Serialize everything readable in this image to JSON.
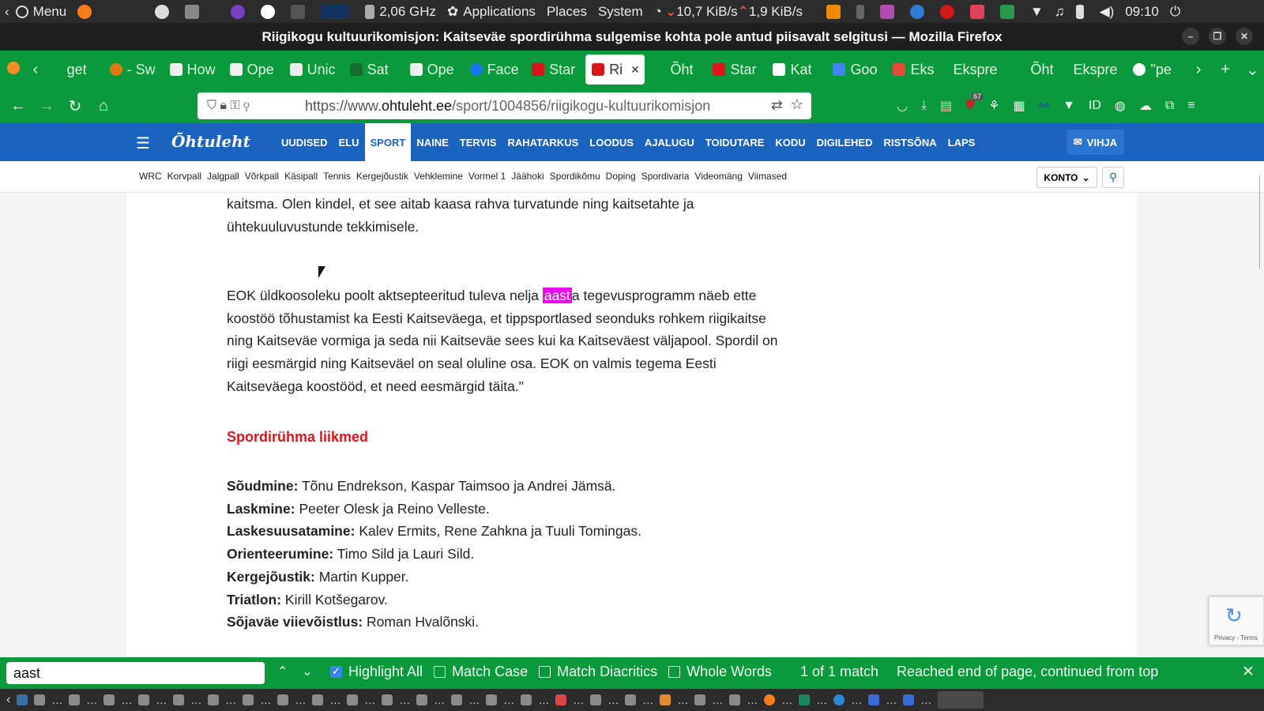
{
  "system_bar": {
    "menu": "Menu",
    "cpu": "2,06 GHz",
    "applications": "Applications",
    "places": "Places",
    "system": "System",
    "download": "10,7 KiB/s",
    "upload": "1,9 KiB/s",
    "clock": "09:10"
  },
  "window": {
    "title": "Riigikogu kultuurikomisjon: Kaitseväe spordirühma sulgemise kohta pole antud piisavalt selgitusi — Mozilla Firefox"
  },
  "tabs": [
    {
      "label": "get"
    },
    {
      "label": "- Sw"
    },
    {
      "label": "How"
    },
    {
      "label": "Ope"
    },
    {
      "label": "Unic"
    },
    {
      "label": "Sat"
    },
    {
      "label": "Ope"
    },
    {
      "label": "Face"
    },
    {
      "label": "Star"
    },
    {
      "label": "Ri"
    },
    {
      "label": "Õht"
    },
    {
      "label": "Star"
    },
    {
      "label": "Kat"
    },
    {
      "label": "Goo"
    },
    {
      "label": "Eks"
    },
    {
      "label": "Ekspre"
    },
    {
      "label": "Õht"
    },
    {
      "label": "Ekspre"
    },
    {
      "label": "\"pe"
    }
  ],
  "url": {
    "scheme": "https://www.",
    "host": "ohtuleht.ee",
    "path": "/sport/1004856/riigikogu-kultuurikomisjon"
  },
  "extension_badge": "67",
  "site": {
    "logo": "Õhtuleht",
    "menu": [
      "UUDISED",
      "ELU",
      "SPORT",
      "NAINE",
      "TERVIS",
      "RAHATARKUS",
      "LOODUS",
      "AJALUGU",
      "TOIDUTARE",
      "KODU",
      "DIGILEHED",
      "RISTSÕNA",
      "LAPS"
    ],
    "vihja": "VIHJA",
    "subnav": [
      "WRC",
      "Korvpall",
      "Jalgpall",
      "Võrkpall",
      "Käsipall",
      "Tennis",
      "Kergejõustik",
      "Vehklemine",
      "Vormel 1",
      "Jäähoki",
      "Spordikõmu",
      "Doping",
      "Spordivaria",
      "Videomäng",
      "Viimased"
    ],
    "konto": "KONTO"
  },
  "article": {
    "p1_line1": "kaitsma. Olen kindel, et see aitab kaasa rahva turvatunde ning kaitsetahte ja",
    "p1_line2": "ühtekuuluvustunde tekkimisele.",
    "p2_before": "EOK üldkoosoleku poolt aktsepteeritud tuleva nelja ",
    "p2_highlight": "aast",
    "p2_after": "a tegevusprogramm näeb ette koostöö tõhustamist ka Eesti Kaitseväega, et tippsportlased seonduks rohkem riigikaitse ning Kaitseväe vormiga ja seda nii Kaitseväe sees kui ka Kaitseväest väljapool. Spordil on riigi eesmärgid ning Kaitseväel on seal oluline osa. EOK on valmis tegema Eesti Kaitseväega koostööd, et need eesmärgid täita.\"",
    "heading": "Spordirühma liikmed",
    "members": [
      {
        "sport": "Sõudmine:",
        "names": "Tõnu Endrekson, Kaspar Taimsoo ja Andrei Jämsä."
      },
      {
        "sport": "Laskmine:",
        "names": "Peeter Olesk ja Reino Velleste."
      },
      {
        "sport": "Laskesuusatamine:",
        "names": "Kalev Ermits, Rene Zahkna ja Tuuli Tomingas."
      },
      {
        "sport": "Orienteerumine:",
        "names": "Timo Sild ja Lauri Sild."
      },
      {
        "sport": "Kergejõustik:",
        "names": "Martin Kupper."
      },
      {
        "sport": "Triatlon:",
        "names": "Kirill Kotšegarov."
      },
      {
        "sport": "Sõjaväe viievõistlus:",
        "names": "Roman Hvalõnski."
      }
    ]
  },
  "recaptcha": "Privacy - Terms",
  "findbar": {
    "query": "aast",
    "highlight_all": "Highlight All",
    "match_case": "Match Case",
    "match_diacritics": "Match Diacritics",
    "whole_words": "Whole Words",
    "status": "1 of 1 match",
    "message": "Reached end of page, continued from top"
  }
}
